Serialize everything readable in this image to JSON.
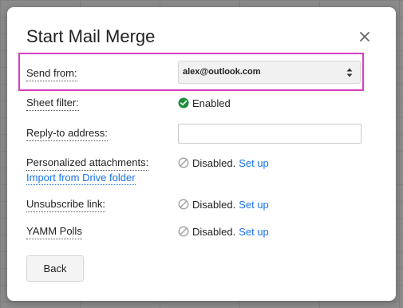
{
  "dialog": {
    "title": "Start Mail Merge"
  },
  "rows": {
    "send_from": {
      "label": "Send from:",
      "selected": "alex@outlook.com"
    },
    "sheet_filter": {
      "label": "Sheet filter:",
      "status": "Enabled"
    },
    "reply_to": {
      "label": "Reply-to address:",
      "value": "",
      "placeholder": ""
    },
    "attachments": {
      "label": "Personalized attachments:",
      "sublink": "Import from Drive folder",
      "status": "Disabled.",
      "action": "Set up"
    },
    "unsubscribe": {
      "label": "Unsubscribe link:",
      "status": "Disabled.",
      "action": "Set up"
    },
    "polls": {
      "label": "YAMM Polls",
      "status": "Disabled.",
      "action": "Set up"
    }
  },
  "footer": {
    "back_label": "Back"
  },
  "icons": {
    "close": "close-icon",
    "select_arrows": "up-down-arrows-icon",
    "enabled": "check-circle-icon",
    "disabled": "disabled-circle-icon"
  },
  "colors": {
    "highlight_border": "#d63fbf",
    "link": "#1a73e8",
    "enabled_green": "#1e8e3e",
    "disabled_grey": "#9e9e9e"
  }
}
